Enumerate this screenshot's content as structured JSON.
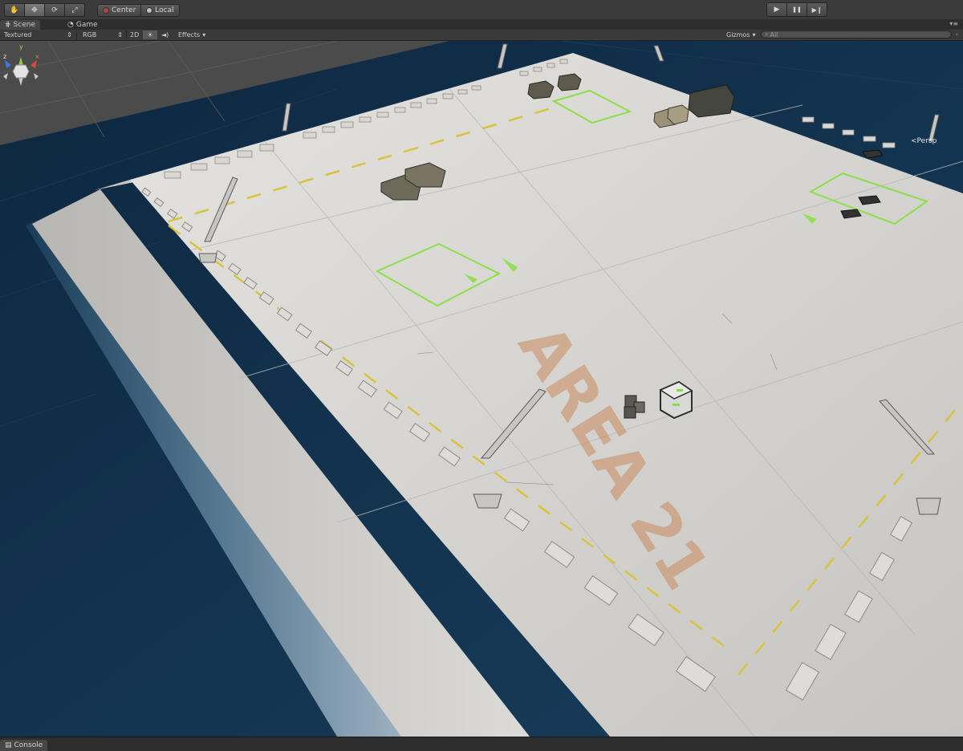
{
  "toolbar": {
    "tools": [
      {
        "icon": "hand-icon",
        "label": "✋"
      },
      {
        "icon": "move-icon",
        "label": "✥"
      },
      {
        "icon": "rotate-icon",
        "label": "⟳"
      },
      {
        "icon": "scale-icon",
        "label": "⤢"
      }
    ],
    "pivot_center_label": "Center",
    "pivot_local_label": "Local",
    "play": {
      "play_label": "▶",
      "pause_label": "❚❚",
      "step_label": "▶❙"
    }
  },
  "tabs": {
    "scene_label": "Scene",
    "game_label": "Game",
    "menu_label": "▾≡"
  },
  "scene_toolbar": {
    "shading_mode": "Textured",
    "render_mode": "RGB",
    "mode_2d": "2D",
    "effects_label": "Effects",
    "gizmos_label": "Gizmos",
    "search_placeholder": "All"
  },
  "gizmo": {
    "axis_y": "y",
    "axis_x": "x",
    "axis_z": "z",
    "projection": "Persp"
  },
  "scene": {
    "ground_marking": "AREA 21"
  },
  "console": {
    "label": "Console"
  },
  "colors": {
    "water": "#12344f",
    "grid_background": "#4a4a4a",
    "platform": "#d6d4cf",
    "marking_green": "#8be04a",
    "marking_yellow": "#d8c33c"
  }
}
